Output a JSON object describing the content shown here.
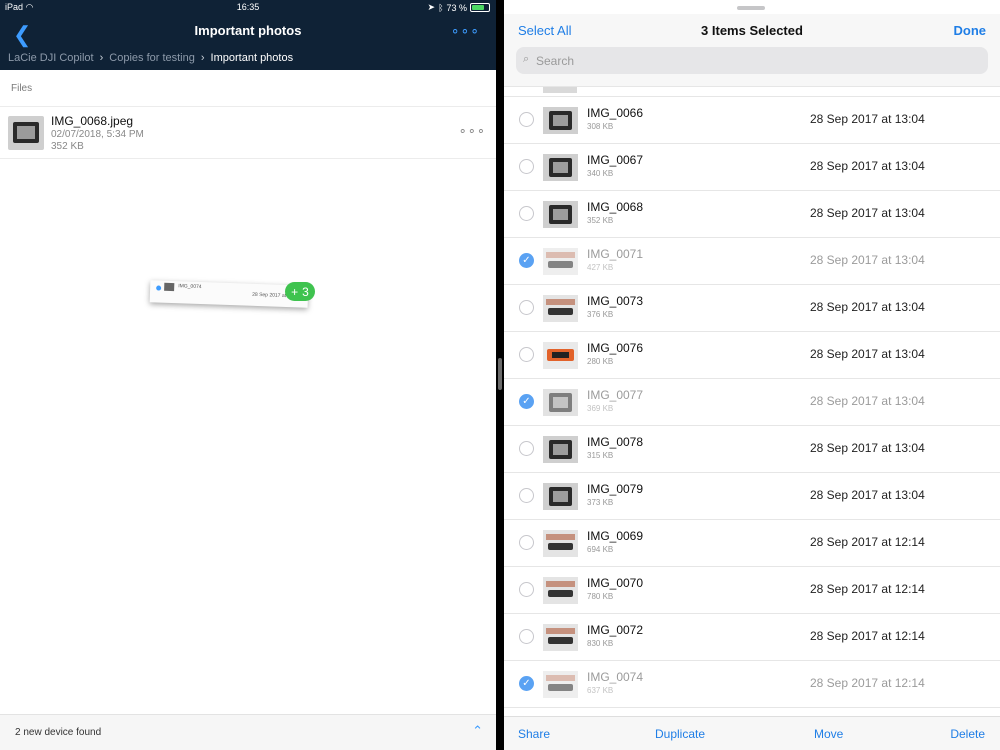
{
  "status_bar": {
    "device": "iPad",
    "time": "16:35",
    "battery_text": "73 %",
    "battery_level": 0.73
  },
  "left": {
    "nav_title": "Important photos",
    "back_icon": "chevron-left-icon",
    "more_icon": "ellipsis-icon",
    "breadcrumbs": [
      "LaCie DJI Copilot",
      "Copies for testing",
      "Important photos"
    ],
    "section_label": "Files",
    "file": {
      "name": "IMG_0068.jpeg",
      "date": "02/07/2018, 5:34 PM",
      "size": "352 KB"
    },
    "drag": {
      "badge_plus": "+",
      "badge_count": "3",
      "mini_name": "IMG_0074",
      "mini_date": "28 Sep 2017 at 12:14"
    },
    "bottom_message": "2 new device found"
  },
  "right": {
    "select_all": "Select All",
    "title": "3 Items Selected",
    "done": "Done",
    "search_placeholder": "Search",
    "items": [
      {
        "name": "IMG_0066",
        "size": "308 KB",
        "date": "28 Sep 2017 at 13:04",
        "selected": false,
        "thumb": "dev"
      },
      {
        "name": "IMG_0067",
        "size": "340 KB",
        "date": "28 Sep 2017 at 13:04",
        "selected": false,
        "thumb": "dev"
      },
      {
        "name": "IMG_0068",
        "size": "352 KB",
        "date": "28 Sep 2017 at 13:04",
        "selected": false,
        "thumb": "dev"
      },
      {
        "name": "IMG_0071",
        "size": "427 KB",
        "date": "28 Sep 2017 at 13:04",
        "selected": true,
        "thumb": "shelf"
      },
      {
        "name": "IMG_0073",
        "size": "376 KB",
        "date": "28 Sep 2017 at 13:04",
        "selected": false,
        "thumb": "shelf"
      },
      {
        "name": "IMG_0076",
        "size": "280 KB",
        "date": "28 Sep 2017 at 13:04",
        "selected": false,
        "thumb": "orange"
      },
      {
        "name": "IMG_0077",
        "size": "369 KB",
        "date": "28 Sep 2017 at 13:04",
        "selected": true,
        "thumb": "dev"
      },
      {
        "name": "IMG_0078",
        "size": "315 KB",
        "date": "28 Sep 2017 at 13:04",
        "selected": false,
        "thumb": "dev"
      },
      {
        "name": "IMG_0079",
        "size": "373 KB",
        "date": "28 Sep 2017 at 13:04",
        "selected": false,
        "thumb": "dev"
      },
      {
        "name": "IMG_0069",
        "size": "694 KB",
        "date": "28 Sep 2017 at 12:14",
        "selected": false,
        "thumb": "shelf"
      },
      {
        "name": "IMG_0070",
        "size": "780 KB",
        "date": "28 Sep 2017 at 12:14",
        "selected": false,
        "thumb": "shelf"
      },
      {
        "name": "IMG_0072",
        "size": "830 KB",
        "date": "28 Sep 2017 at 12:14",
        "selected": false,
        "thumb": "shelf"
      },
      {
        "name": "IMG_0074",
        "size": "637 KB",
        "date": "28 Sep 2017 at 12:14",
        "selected": true,
        "thumb": "shelf"
      }
    ],
    "toolbar": {
      "share": "Share",
      "duplicate": "Duplicate",
      "move": "Move",
      "delete": "Delete"
    }
  },
  "colors": {
    "nav_dark": "#0f2236",
    "accent_blue": "#1f7ee6",
    "badge_green": "#3fc34f",
    "check_blue": "#5aa2f3"
  }
}
